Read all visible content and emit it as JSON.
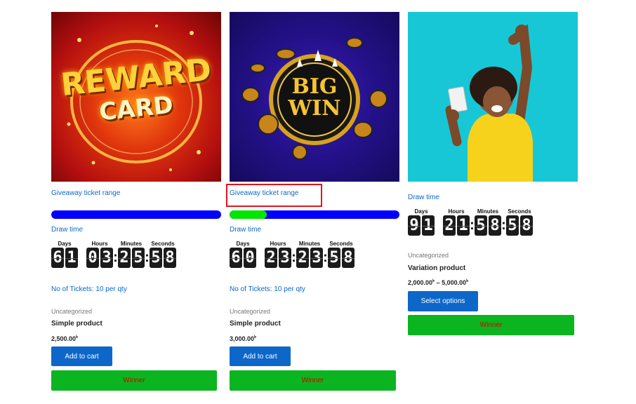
{
  "products": [
    {
      "image_alt": "REWARD CARD",
      "image_text": {
        "line1": "REWARD",
        "line2": "CARD"
      },
      "range_link": "Giveaway ticket range",
      "progress_fraction": 0,
      "draw_time": "Draw time",
      "timer": {
        "labels": {
          "days": "Days",
          "hours": "Hours",
          "minutes": "Minutes",
          "seconds": "Seconds"
        },
        "days": [
          "6",
          "1"
        ],
        "hours": [
          "0",
          "3"
        ],
        "minutes": [
          "2",
          "5"
        ],
        "seconds": [
          "5",
          "8"
        ]
      },
      "tickets": "No of Tickets: 10 per qty",
      "category": "Uncategorized",
      "name": "Simple product",
      "price": "2,500.00",
      "currency": "৳",
      "button": "Add to cart",
      "winner": "Winner"
    },
    {
      "image_alt": "BIG WIN",
      "image_text": {
        "line1": "BIG",
        "line2": "WIN"
      },
      "range_link": "Giveaway ticket range",
      "progress_fraction": 0.22,
      "draw_time": "Draw time",
      "timer": {
        "labels": {
          "days": "Days",
          "hours": "Hours",
          "minutes": "Minutes",
          "seconds": "Seconds"
        },
        "days": [
          "6",
          "0"
        ],
        "hours": [
          "2",
          "3"
        ],
        "minutes": [
          "2",
          "3"
        ],
        "seconds": [
          "5",
          "8"
        ]
      },
      "tickets": "No of Tickets: 10 per qty",
      "category": "Uncategorized",
      "name": "Simple product",
      "price": "3,000.00",
      "currency": "৳",
      "button": "Add to cart",
      "winner": "Winner"
    },
    {
      "image_alt": "Woman cheering with lottery ticket",
      "draw_time": "Draw time",
      "timer": {
        "labels": {
          "days": "Days",
          "hours": "Hours",
          "minutes": "Minutes",
          "seconds": "Seconds"
        },
        "days": [
          "9",
          "1"
        ],
        "hours": [
          "2",
          "1"
        ],
        "minutes": [
          "5",
          "8"
        ],
        "seconds": [
          "5",
          "8"
        ]
      },
      "category": "Uncategorized",
      "name": "Variation product",
      "price_min": "2,000.00",
      "price_max": "5,000.00",
      "currency": "৳",
      "price_sep": "–",
      "button": "Select options",
      "winner": "Winner"
    }
  ],
  "colors": {
    "accent_blue": "#0d67c9",
    "progress_track": "#0000ff",
    "progress_fill": "#00e600",
    "winner_bg": "#0bb51f",
    "winner_text": "#d40000",
    "highlight": "#e3141e"
  }
}
